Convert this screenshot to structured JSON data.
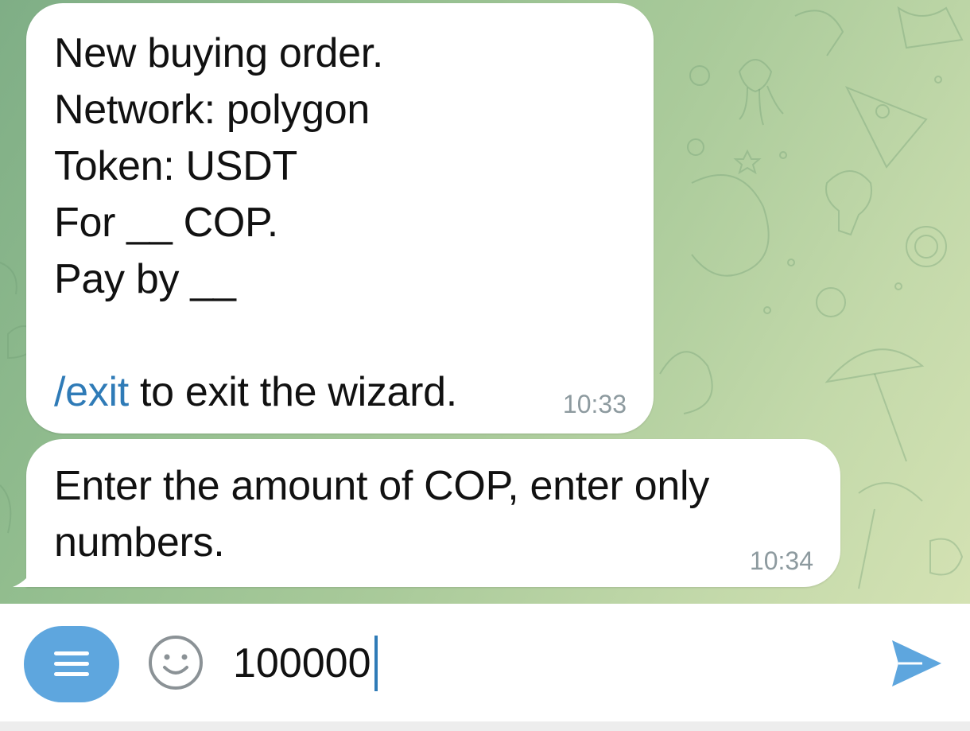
{
  "messages": [
    {
      "lines": [
        "New buying order.",
        "Network: polygon",
        "Token: USDT",
        "For __ COP.",
        "Pay by __",
        ""
      ],
      "command": "/exit",
      "command_suffix": " to exit the wizard.",
      "time": "10:33"
    },
    {
      "text": "Enter the amount of COP, enter only numbers.",
      "time": "10:34"
    }
  ],
  "input": {
    "value": "100000"
  },
  "icons": {
    "menu": "menu-lines-icon",
    "emoji": "smiley-icon",
    "send": "send-arrow-icon"
  },
  "colors": {
    "accent": "#5ea6de",
    "link": "#2f7bb7",
    "timestamp": "#8d9a9f",
    "send": "#5ea6de"
  }
}
